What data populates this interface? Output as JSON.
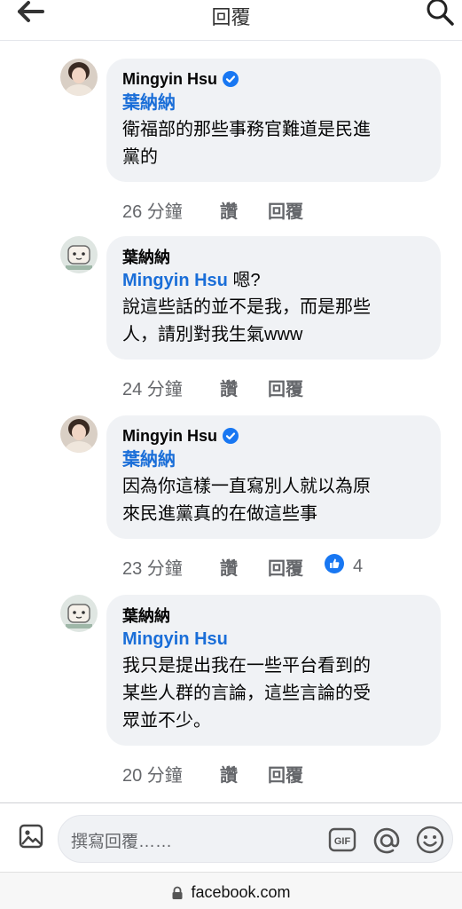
{
  "header": {
    "title": "回覆"
  },
  "comments": [
    {
      "author": "Mingyin Hsu",
      "verified": true,
      "mention": "葉納納",
      "text_lines": [
        "衛福部的那些事務官難道是民進",
        "黨的"
      ],
      "time": "26 分鐘",
      "like_label": "讚",
      "reply_label": "回覆"
    },
    {
      "author": "葉納納",
      "verified": false,
      "mention": "Mingyin Hsu",
      "text_lines": [
        " 嗯?",
        "說這些話的並不是我，而是那些",
        "人，請別對我生氣www"
      ],
      "time": "24 分鐘",
      "like_label": "讚",
      "reply_label": "回覆"
    },
    {
      "author": "Mingyin Hsu",
      "verified": true,
      "mention": "葉納納",
      "text_lines": [
        "因為你這樣一直寫別人就以為原",
        "來民進黨真的在做這些事"
      ],
      "time": "23 分鐘",
      "like_label": "讚",
      "reply_label": "回覆",
      "reaction_icon": "like-thumb-icon",
      "reaction_count": "4"
    },
    {
      "author": "葉納納",
      "verified": false,
      "mention": "Mingyin Hsu",
      "text_lines": [
        "我只是提出我在一些平台看到的",
        "某些人群的言論，這些言論的受",
        "眾並不少。"
      ],
      "time": "20 分鐘",
      "like_label": "讚",
      "reply_label": "回覆"
    }
  ],
  "composer": {
    "placeholder": "撰寫回覆……",
    "gif_label": "GIF"
  },
  "browser": {
    "url": "facebook.com"
  },
  "colors": {
    "link_blue": "#1a6ed8",
    "bubble_bg": "#f0f2f5",
    "meta_gray": "#65676b",
    "verified_blue": "#1877f2"
  }
}
